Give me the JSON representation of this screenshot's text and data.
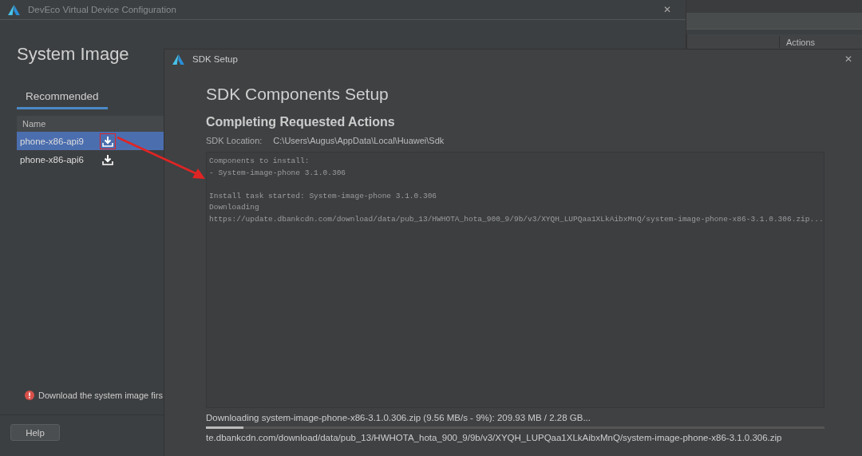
{
  "main_window": {
    "title": "DevEco Virtual Device Configuration",
    "close": "✕",
    "heading": "System Image",
    "tabs": [
      {
        "label": "Recommended",
        "selected": true
      }
    ],
    "table": {
      "columns": [
        "Name"
      ],
      "rows": [
        {
          "name": "phone-x86-api9",
          "selected": true,
          "highlighted": true
        },
        {
          "name": "phone-x86-api6",
          "selected": false,
          "highlighted": false
        }
      ]
    },
    "error": "Download the system image firs",
    "help_button": "Help"
  },
  "background_window": {
    "column_header": "Actions"
  },
  "sdk_dialog": {
    "title": "SDK Setup",
    "close": "✕",
    "heading": "SDK Components Setup",
    "subheading": "Completing Requested Actions",
    "location_label": "SDK Location:",
    "location": "C:\\Users\\Augus\\AppData\\Local\\Huawei\\Sdk",
    "log": [
      {
        "text": "Components to install:",
        "gap_before": false
      },
      {
        "text": "- System-image-phone 3.1.0.306",
        "gap_before": false
      },
      {
        "text": "Install task started: System-image-phone 3.1.0.306",
        "gap_before": true
      },
      {
        "text": "Downloading",
        "gap_before": false
      },
      {
        "text": "https://update.dbankcdn.com/download/data/pub_13/HWHOTA_hota_900_9/9b/v3/XYQH_LUPQaa1XLkAibxMnQ/system-image-phone-x86-3.1.0.306.zip...",
        "gap_before": false
      }
    ],
    "status": "Downloading system-image-phone-x86-3.1.0.306.zip (9.56 MB/s - 9%): 209.93 MB / 2.28 GB...",
    "progress": {
      "level": 0.06
    },
    "url": "te.dbankcdn.com/download/data/pub_13/HWHOTA_hota_900_9/9b/v3/XYQH_LUPQaa1XLkAibxMnQ/system-image-phone-x86-3.1.0.306.zip"
  }
}
